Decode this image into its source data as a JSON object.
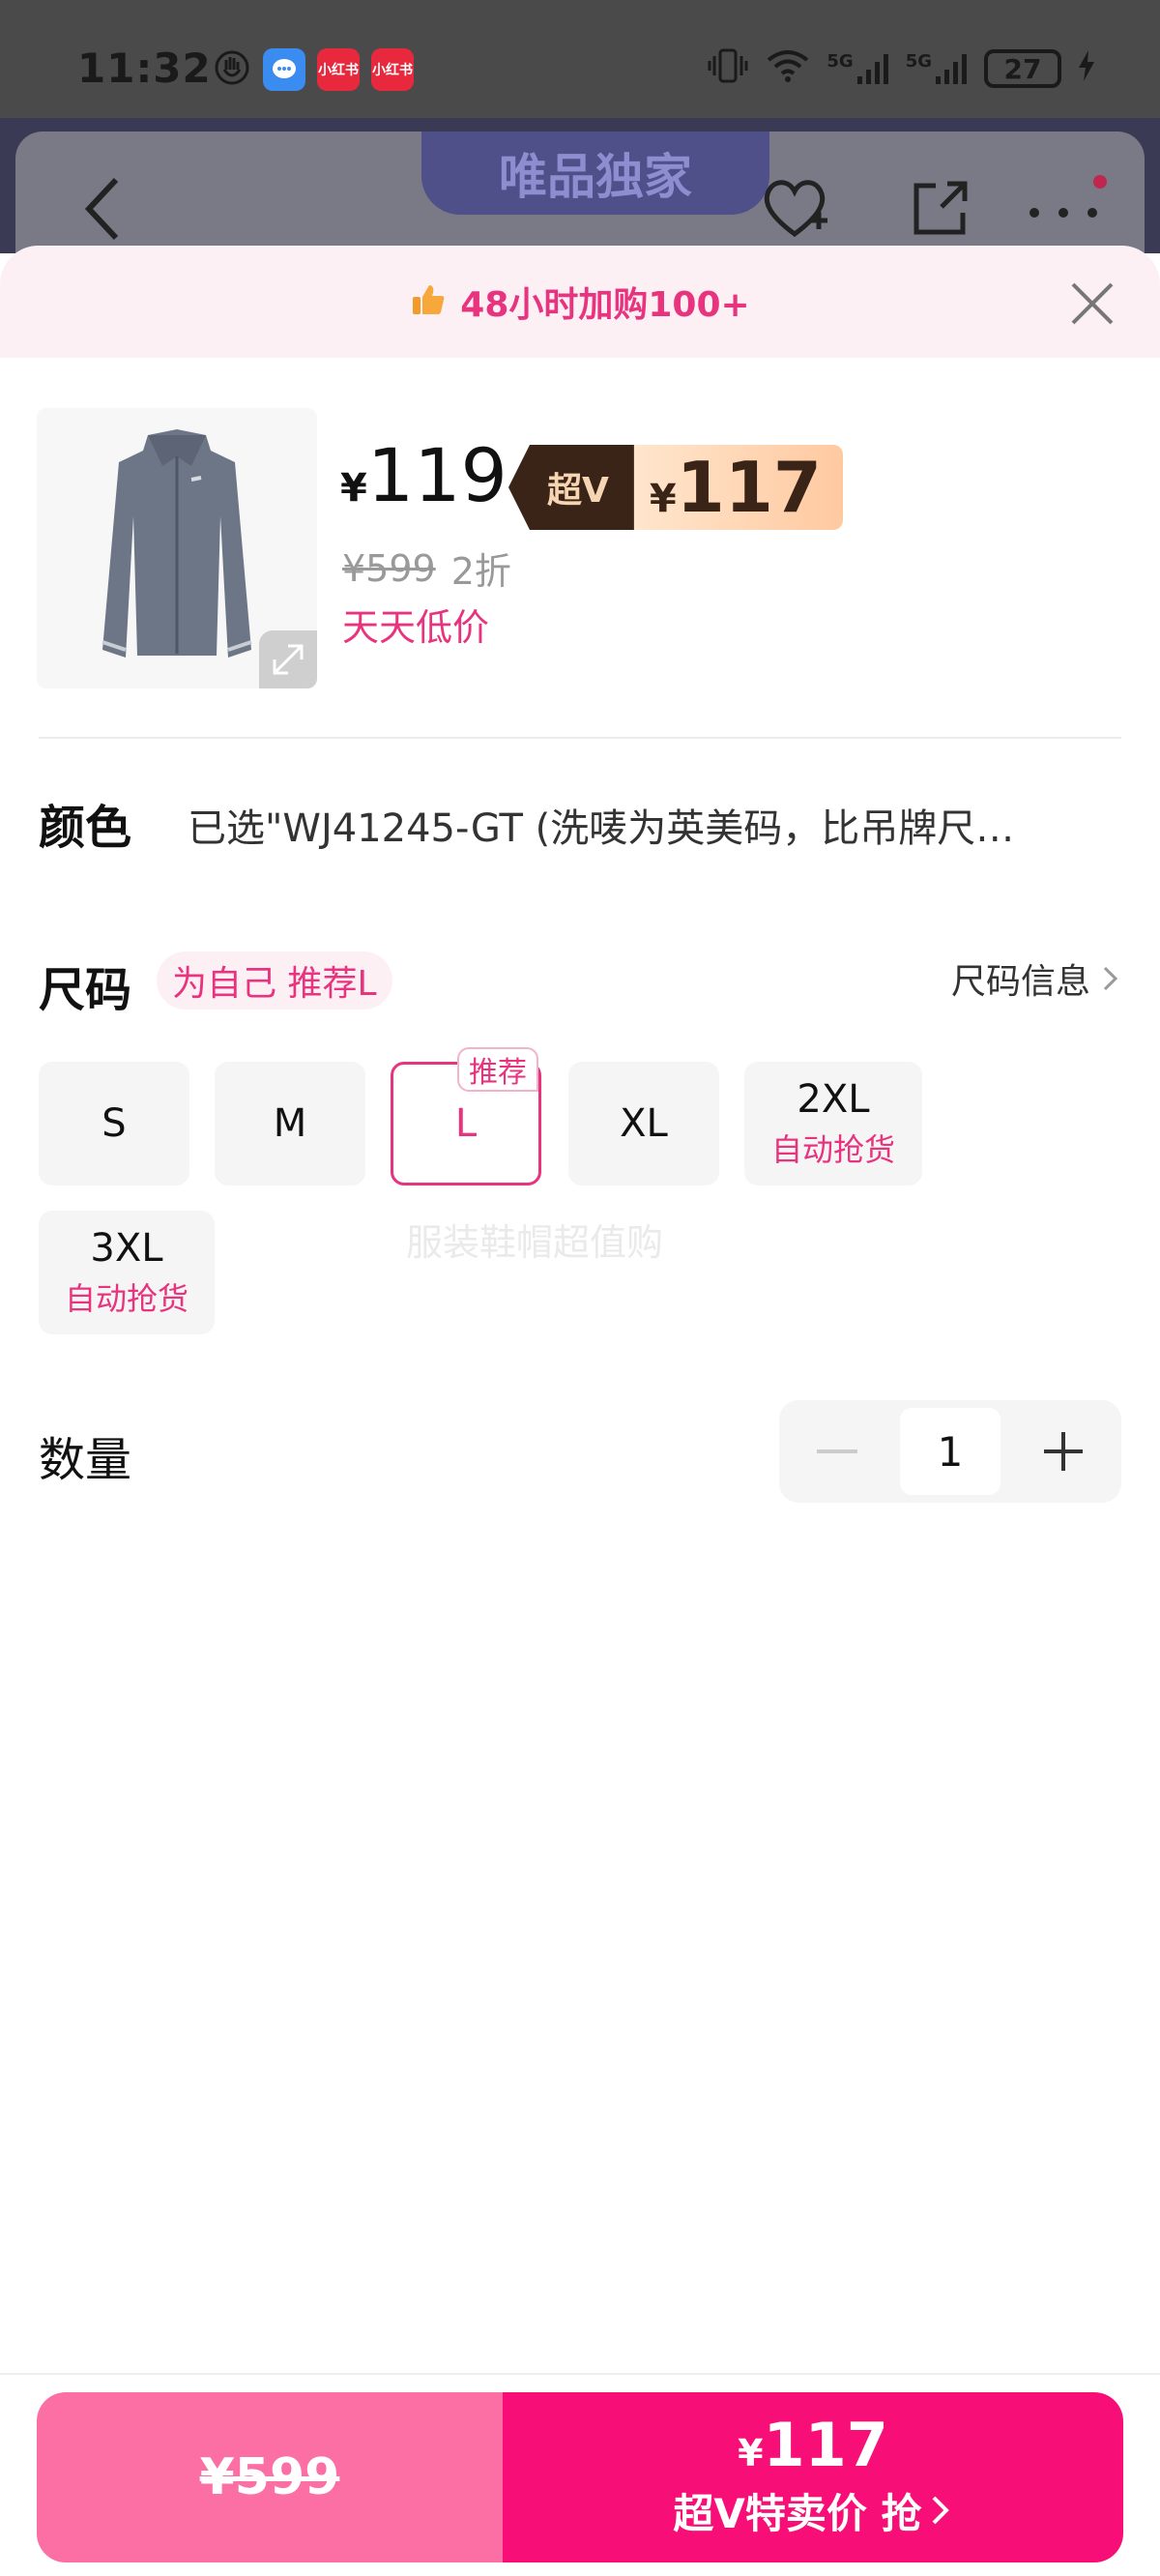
{
  "status_bar": {
    "time": "11:32",
    "apps": [
      "小红书",
      "小红书"
    ],
    "signal": "5G",
    "battery": "27"
  },
  "background_header": {
    "exclusive_label": "唯品独家"
  },
  "promo": {
    "text": "48小时加购100+"
  },
  "product": {
    "currency": "¥",
    "price": "119",
    "superv_label": "超V",
    "superv_price": "117",
    "original_price": "¥599",
    "discount": "2折",
    "daily_low": "天天低价"
  },
  "color": {
    "label": "颜色",
    "value": "已选\"WJ41245-GT (洗唛为英美码，比吊牌尺…"
  },
  "size": {
    "label": "尺码",
    "recommend_tag": "为自己 推荐L",
    "info_link": "尺码信息",
    "selected": "L",
    "options": [
      {
        "label": "S",
        "sub": ""
      },
      {
        "label": "M",
        "sub": ""
      },
      {
        "label": "L",
        "sub": "",
        "badge": "推荐"
      },
      {
        "label": "XL",
        "sub": ""
      },
      {
        "label": "2XL",
        "sub": "自动抢货"
      },
      {
        "label": "3XL",
        "sub": "自动抢货"
      }
    ],
    "watermark": "服装鞋帽超值购"
  },
  "quantity": {
    "label": "数量",
    "value": "1"
  },
  "bottom_bar": {
    "left_price": "¥599",
    "right_currency": "¥",
    "right_price": "117",
    "right_cta": "超V特卖价 抢"
  },
  "colors": {
    "accent_pink": "#e8337f",
    "cta_pink": "#f70f77",
    "cta_light_pink": "#fb6fa5",
    "superv_dark": "#3a2317",
    "superv_gold": "#ffc9a0"
  }
}
